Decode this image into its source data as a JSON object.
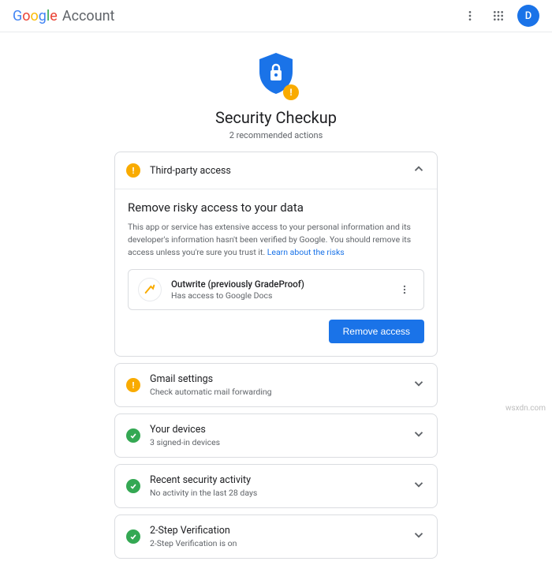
{
  "header": {
    "product": "Account",
    "avatar_initial": "D"
  },
  "hero": {
    "title": "Security Checkup",
    "subtitle": "2 recommended actions"
  },
  "sections": {
    "third_party": {
      "title": "Third-party access",
      "body_title": "Remove risky access to your data",
      "body_text": "This app or service has extensive access to your personal information and its developer's information hasn't been verified by Google. You should remove its access unless you're sure you trust it. ",
      "learn_link": "Learn about the risks",
      "app": {
        "name": "Outwrite (previously GradeProof)",
        "sub": "Has access to Google Docs"
      },
      "remove_btn": "Remove access"
    },
    "gmail": {
      "title": "Gmail settings",
      "sub": "Check automatic mail forwarding"
    },
    "devices": {
      "title": "Your devices",
      "sub": "3 signed-in devices"
    },
    "activity": {
      "title": "Recent security activity",
      "sub": "No activity in the last 28 days"
    },
    "twostep": {
      "title": "2-Step Verification",
      "sub": "2-Step Verification is on"
    }
  },
  "watermark": "wsxdn.com"
}
